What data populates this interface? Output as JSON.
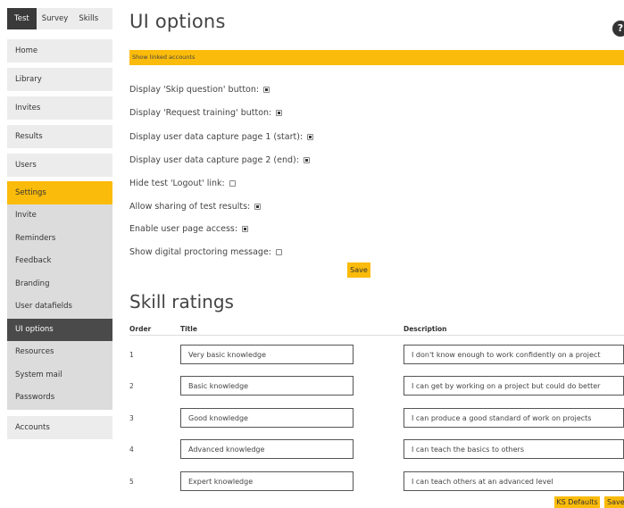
{
  "topnav": {
    "tabs": [
      {
        "label": "Test"
      },
      {
        "label": "Survey"
      },
      {
        "label": "Skills"
      }
    ]
  },
  "sidebar": {
    "home": "Home",
    "library": "Library",
    "invites": "Invites",
    "results": "Results",
    "users": "Users",
    "settings": "Settings",
    "sub": [
      "Invite",
      "Reminders",
      "Feedback",
      "Branding",
      "User datafields",
      "UI options",
      "Resources",
      "System mail",
      "Passwords"
    ],
    "accounts": "Accounts"
  },
  "main": {
    "title": "UI options",
    "help": "?",
    "banner": "Show linked accounts",
    "options": [
      {
        "label": "Display 'Skip question' button:",
        "checked": true
      },
      {
        "label": "Display 'Request training' button:",
        "checked": true
      },
      {
        "label": "Display user data capture page 1 (start):",
        "checked": true
      },
      {
        "label": "Display user data capture page 2 (end):",
        "checked": true
      },
      {
        "label": "Hide test 'Logout' link:",
        "checked": false
      },
      {
        "label": "Allow sharing of test results:",
        "checked": true
      },
      {
        "label": "Enable user page access:",
        "checked": true
      },
      {
        "label": "Show digital proctoring message:",
        "checked": false
      }
    ],
    "save": "Save"
  },
  "skills": {
    "title": "Skill ratings",
    "headers": {
      "order": "Order",
      "title": "Title",
      "description": "Description"
    },
    "rows": [
      {
        "order": "1",
        "title": "Very basic knowledge",
        "description": "I don't know enough to work confidently on a project"
      },
      {
        "order": "2",
        "title": "Basic knowledge",
        "description": "I can get by working on a project but could do better"
      },
      {
        "order": "3",
        "title": "Good knowledge",
        "description": "I can produce a good standard of work on projects"
      },
      {
        "order": "4",
        "title": "Advanced knowledge",
        "description": "I can teach the basics to others"
      },
      {
        "order": "5",
        "title": "Expert knowledge",
        "description": "I can teach others at an advanced level"
      }
    ],
    "ks_defaults": "KS Defaults",
    "save": "Save"
  }
}
